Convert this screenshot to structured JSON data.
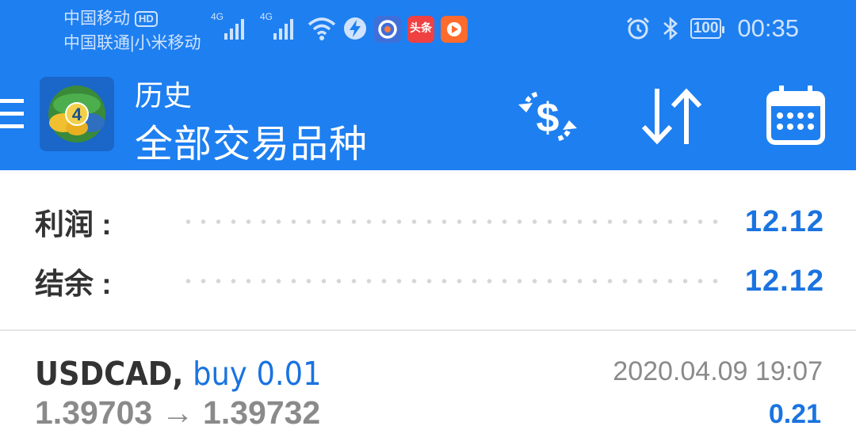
{
  "status_bar": {
    "carrier_1": "中国移动",
    "carrier_1_badge": "HD",
    "carrier_2": "中国联通|小米移动",
    "sim1_network": "4G",
    "sim2_network": "4G",
    "battery": "100",
    "time": "00:35",
    "notification_icons": [
      "wifi-icon",
      "flash-app-icon",
      "browser-app-icon",
      "toutiao-app-icon",
      "video-app-icon"
    ],
    "toutiao_label": "头条"
  },
  "toolbar": {
    "title": "历史",
    "subtitle": "全部交易品种",
    "logo_badge": "4",
    "icons": [
      "currency-exchange-icon",
      "sort-icon",
      "calendar-icon"
    ],
    "accent_color": "#1e7ff0"
  },
  "summary": {
    "profit_label": "利润 :",
    "profit_value": "12.12",
    "balance_label": "结余 :",
    "balance_value": "12.12"
  },
  "trades": [
    {
      "symbol": "USDCAD,",
      "side": "buy 0.01",
      "open_price": "1.39703",
      "arrow": "→",
      "close_price": "1.39732",
      "time": "2020.04.09 19:07",
      "profit": "0.21"
    }
  ]
}
